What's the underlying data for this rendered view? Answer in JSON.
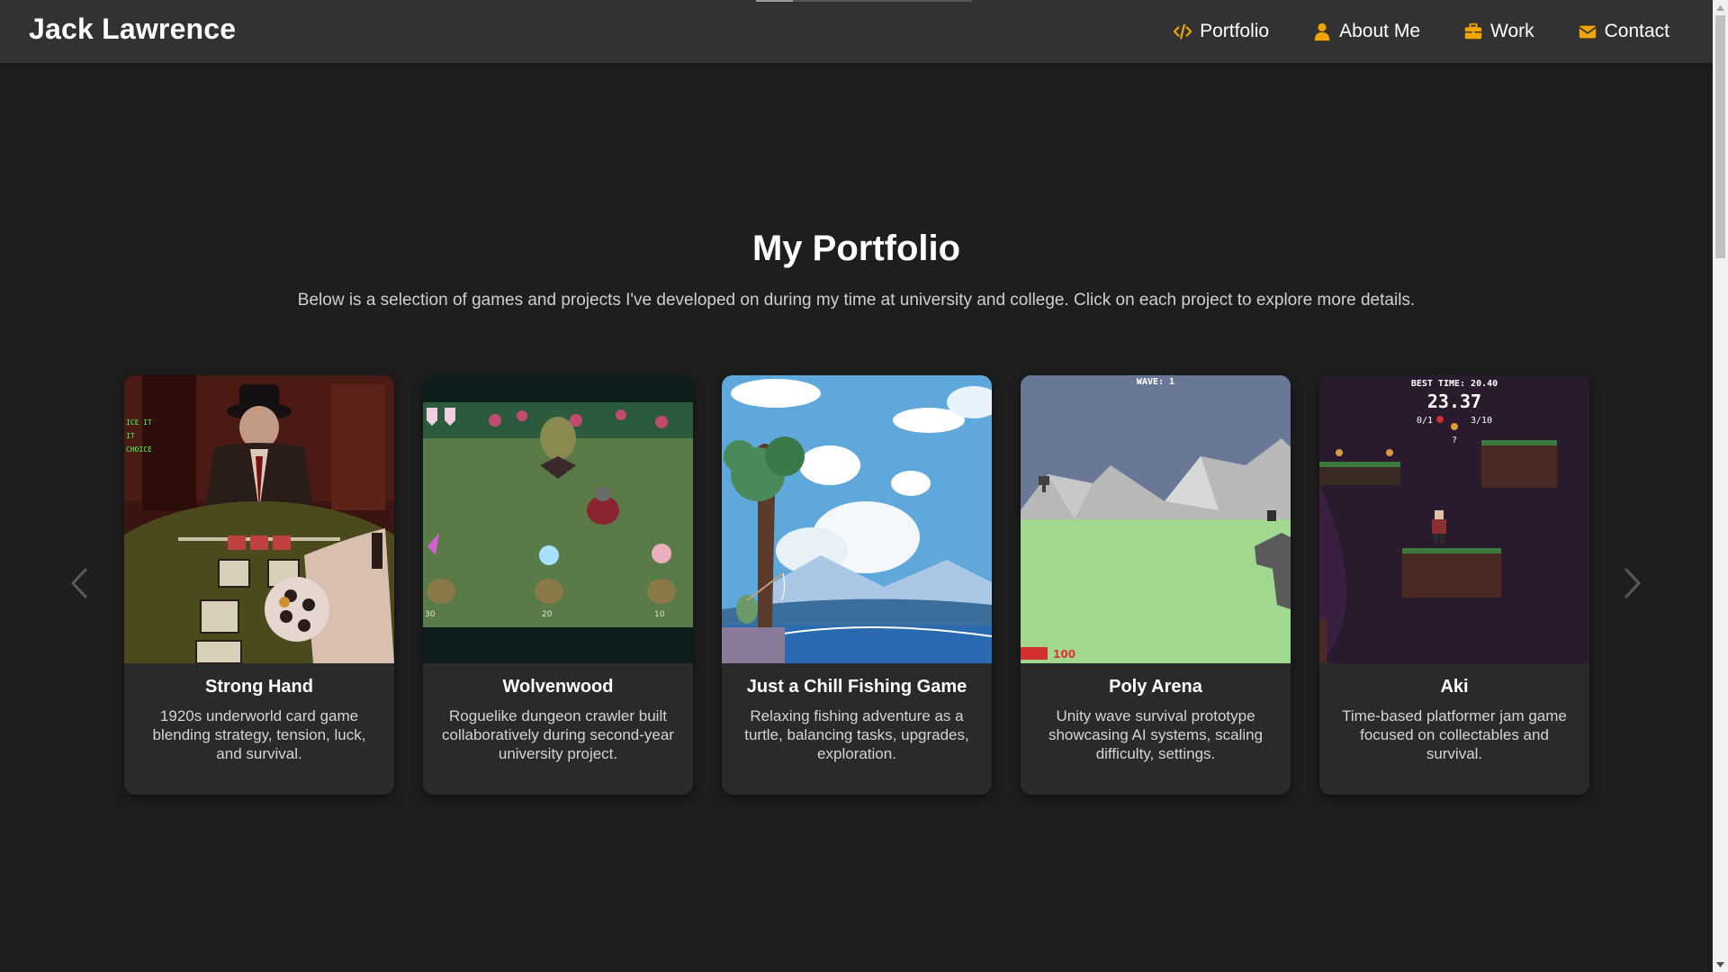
{
  "header": {
    "brand": "Jack Lawrence",
    "nav": [
      {
        "label": "Portfolio",
        "icon": "code-icon"
      },
      {
        "label": "About Me",
        "icon": "user-icon"
      },
      {
        "label": "Work",
        "icon": "briefcase-icon"
      },
      {
        "label": "Contact",
        "icon": "envelope-icon"
      }
    ],
    "accent": "#f0a500"
  },
  "portfolio": {
    "title": "My Portfolio",
    "subtitle": "Below is a selection of games and projects I've developed on during my time at university and college. Click on each project to explore more details.",
    "projects": [
      {
        "title": "Strong Hand",
        "description": "1920s underworld card game blending strategy, tension, luck, and survival.",
        "overlay_text": [
          "ICE IT",
          "IT",
          "CHOICE"
        ]
      },
      {
        "title": "Wolvenwood",
        "description": "Roguelike dungeon crawler built collaboratively during second-year university project.",
        "overlay_text": [
          "30",
          "20",
          "10"
        ]
      },
      {
        "title": "Just a Chill Fishing Game",
        "description": "Relaxing fishing adventure as a turtle, balancing tasks, upgrades, exploration."
      },
      {
        "title": "Poly Arena",
        "description": "Unity wave survival prototype showcasing AI systems, scaling difficulty, settings.",
        "overlay_text": [
          "WAVE: 1",
          "100"
        ]
      },
      {
        "title": "Aki",
        "description": "Time-based platformer jam game focused on collectables and survival.",
        "overlay_text": [
          "BEST TIME: 20.40",
          "23.37",
          "0/1",
          "3/10",
          "?"
        ]
      }
    ]
  },
  "colors": {
    "background": "#1e1e1e",
    "header_bg": "#323232",
    "card_bg": "#2a2a2a"
  }
}
